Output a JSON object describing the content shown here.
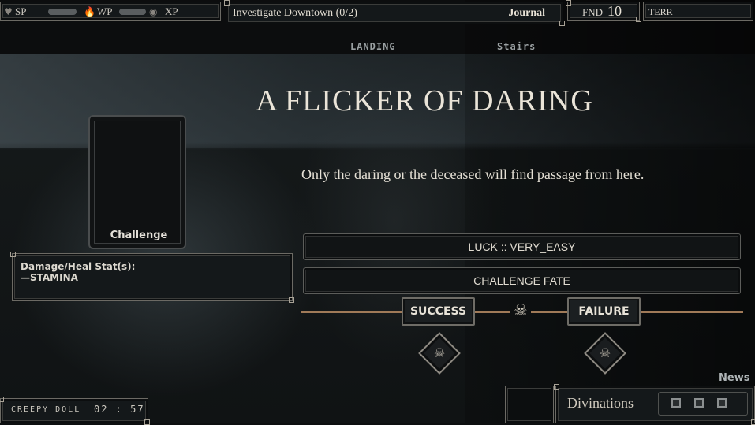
{
  "hud": {
    "sp_label": "SP",
    "wp_label": "WP",
    "xp_label": "XP",
    "icons": [
      "heart-icon",
      "flame-icon",
      "coin-icon"
    ]
  },
  "quest": {
    "title": "Investigate Downtown (0/2)",
    "journal_label": "Journal"
  },
  "fnd": {
    "label": "FND",
    "value": "10"
  },
  "terr": {
    "label": "TERR"
  },
  "locations": {
    "left": "LANDING",
    "right": "Stairs"
  },
  "event": {
    "title": "A FLICKER OF DARING",
    "text": "Only the daring or the deceased will find passage from here."
  },
  "card": {
    "label": "Challenge"
  },
  "stats_box": {
    "label": "Damage/Heal Stat(s):",
    "value": "—STAMINA"
  },
  "options": {
    "luck": "LUCK :: VERY_EASY",
    "fate": "CHALLENGE FATE"
  },
  "outcomes": {
    "success": "SUCCESS",
    "failure": "FAILURE"
  },
  "news": {
    "label": "News"
  },
  "divinations": {
    "label": "Divinations",
    "slot_count": 3
  },
  "recording": {
    "label": "CREEPY DOLL",
    "time": "02 : 57"
  },
  "colors": {
    "track": "#a07a58",
    "frame": "#6c6a64",
    "panel": "#14181a"
  }
}
